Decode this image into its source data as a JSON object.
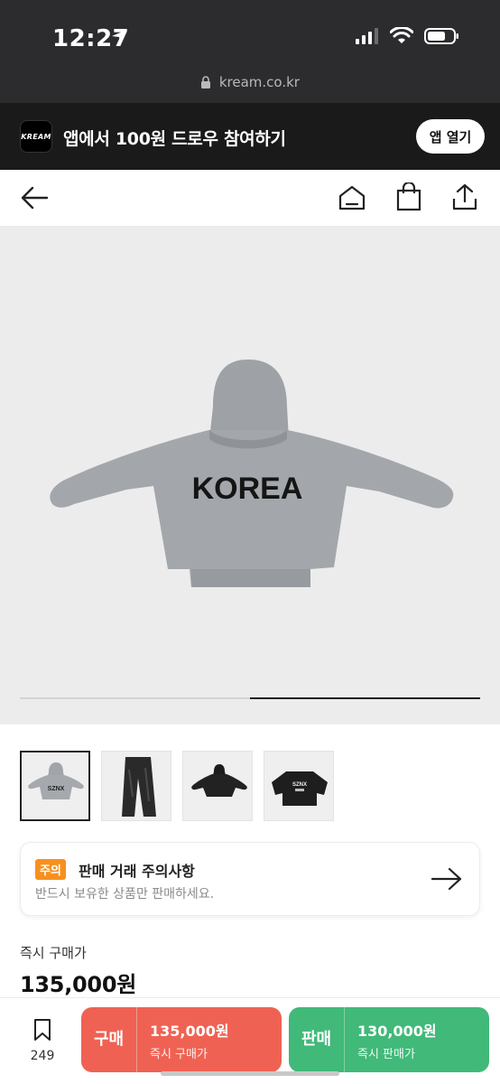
{
  "status_bar": {
    "time": "12:27"
  },
  "browser": {
    "url": "kream.co.kr"
  },
  "app_banner": {
    "logo_text": "KREAM",
    "message": "앱에서 100원 드로우 참여하기",
    "open_button": "앱 열기"
  },
  "product": {
    "image_text": "KOREA",
    "carousel_progress": 0.5,
    "thumbnail_texts": {
      "t1": "SZNX",
      "t3": "SZNX"
    }
  },
  "notice": {
    "badge": "주의",
    "title": "판매 거래 주의사항",
    "subtitle": "반드시 보유한 상품만 판매하세요."
  },
  "price": {
    "label": "즉시 구매가",
    "value": "135,000원"
  },
  "bottom_bar": {
    "wish_count": "249",
    "buy": {
      "label": "구매",
      "price": "135,000원",
      "sub": "즉시 구매가"
    },
    "sell": {
      "label": "판매",
      "price": "130,000원",
      "sub": "즉시 판매가"
    }
  },
  "colors": {
    "buy": "#ef6253",
    "sell": "#41b979",
    "notice_badge": "#f7901e"
  }
}
